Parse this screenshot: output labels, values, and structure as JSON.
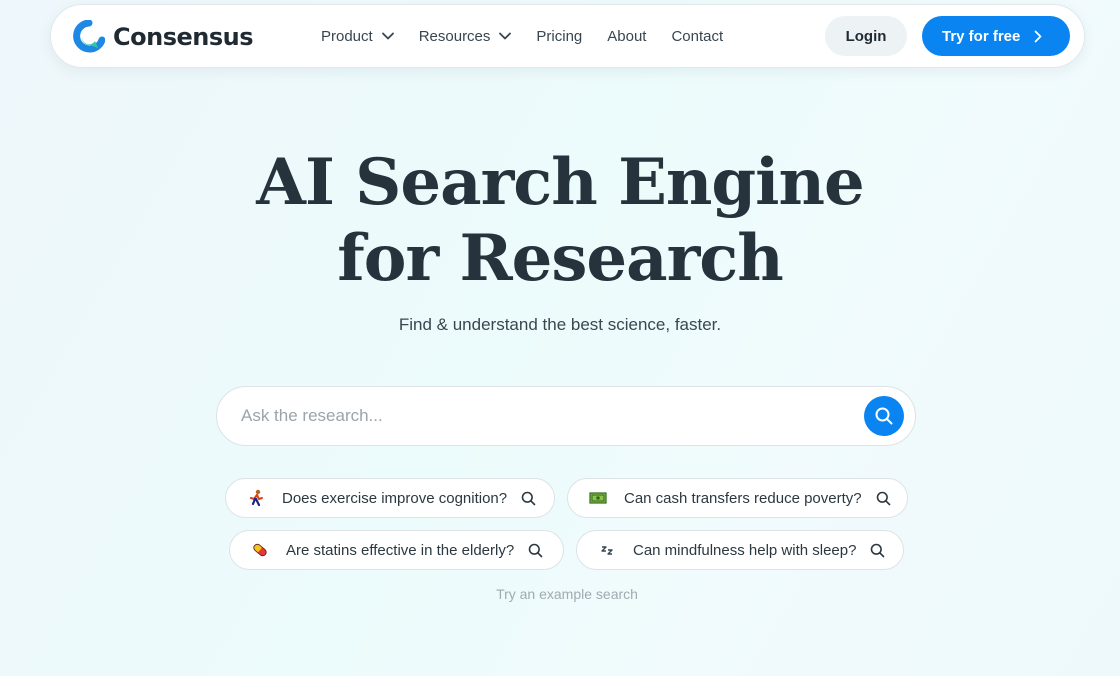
{
  "brand": {
    "name": "Consensus",
    "logo_colors": [
      "#1e88e5",
      "#34c6a0"
    ]
  },
  "nav": {
    "items": [
      {
        "label": "Product",
        "has_dropdown": true
      },
      {
        "label": "Resources",
        "has_dropdown": true
      },
      {
        "label": "Pricing",
        "has_dropdown": false
      },
      {
        "label": "About",
        "has_dropdown": false
      },
      {
        "label": "Contact",
        "has_dropdown": false
      }
    ],
    "login_label": "Login",
    "try_label": "Try for free"
  },
  "hero": {
    "title_line1": "AI Search Engine",
    "title_line2": "for Research",
    "subtitle": "Find & understand the best science, faster."
  },
  "search": {
    "placeholder": "Ask the research...",
    "value": ""
  },
  "examples": {
    "items": [
      {
        "text": "Does exercise improve cognition?",
        "icon": "running-person-icon"
      },
      {
        "text": "Can cash transfers reduce poverty?",
        "icon": "money-icon"
      },
      {
        "text": "Are statins effective in the elderly?",
        "icon": "pill-icon"
      },
      {
        "text": "Can mindfulness help with sleep?",
        "icon": "sleep-icon"
      }
    ],
    "note": "Try an example search"
  },
  "colors": {
    "accent": "#0a84f0",
    "text": "#1f2a33",
    "muted": "#a0aab0"
  }
}
